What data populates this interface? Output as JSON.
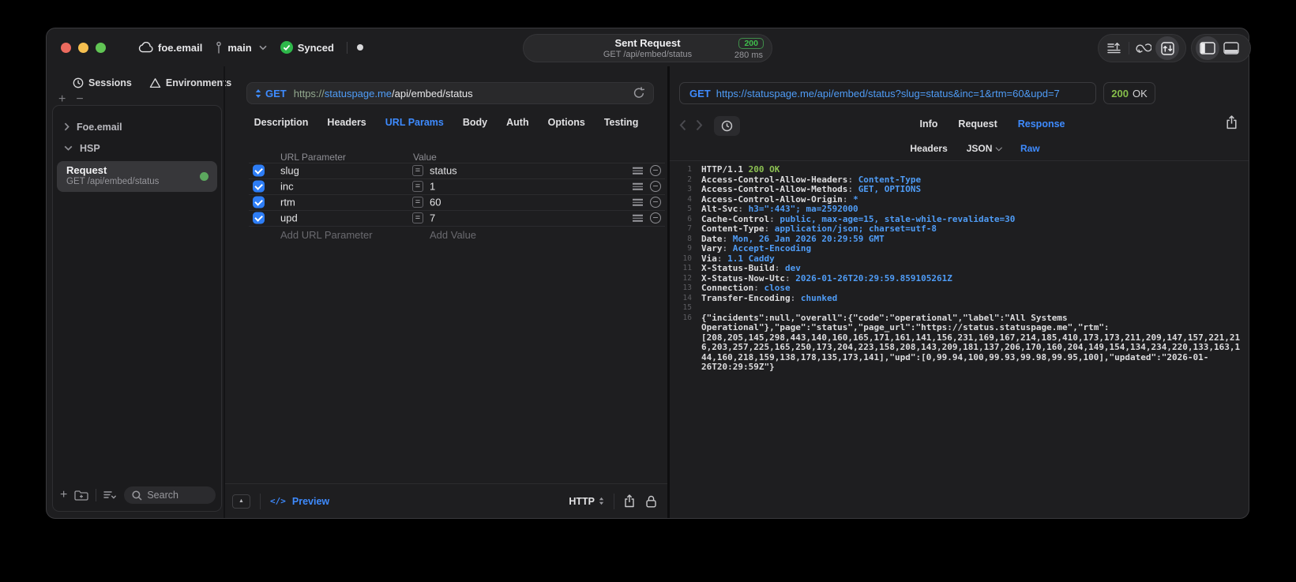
{
  "titlebar": {
    "project": "foe.email",
    "branch": "main",
    "sync_status": "Synced",
    "request_summary": {
      "title": "Sent Request",
      "status_code": "200",
      "method_path": "GET /api/embed/status",
      "duration": "280 ms"
    }
  },
  "sidebar": {
    "tabs": [
      {
        "label": "Sessions",
        "icon": "clock-icon"
      },
      {
        "label": "Environments",
        "icon": "environments-icon"
      }
    ],
    "groups": [
      {
        "label": "Foe.email",
        "state": "collapsed"
      },
      {
        "label": "HSP",
        "state": "expanded"
      }
    ],
    "request_item": {
      "title": "Request",
      "subtitle": "GET /api/embed/status",
      "status_dot_color": "#5CA85E"
    },
    "search": {
      "placeholder": "Search"
    }
  },
  "request_panel": {
    "method": "GET",
    "url": {
      "scheme": "https://",
      "host": "statuspage.me",
      "path": "/api/embed/status"
    },
    "tabs": [
      "Description",
      "Headers",
      "URL Params",
      "Body",
      "Auth",
      "Options",
      "Testing"
    ],
    "active_tab": "URL Params",
    "params_table": {
      "columns": [
        "URL Parameter",
        "Value"
      ],
      "rows": [
        {
          "name": "slug",
          "value": "status",
          "checked": true
        },
        {
          "name": "inc",
          "value": "1",
          "checked": true
        },
        {
          "name": "rtm",
          "value": "60",
          "checked": true
        },
        {
          "name": "upd",
          "value": "7",
          "checked": true
        }
      ],
      "add_row": {
        "name_placeholder": "Add URL Parameter",
        "value_placeholder": "Add Value"
      }
    },
    "footer": {
      "code_glyph": "</>",
      "preview_label": "Preview",
      "protocol": "HTTP"
    }
  },
  "response_panel": {
    "request_line": {
      "method": "GET",
      "url": "https://statuspage.me/api/embed/status?slug=status&inc=1&rtm=60&upd=7"
    },
    "status": {
      "code": "200",
      "text": "OK"
    },
    "tabs": [
      "Info",
      "Request",
      "Response"
    ],
    "active_tab": "Response",
    "subtabs": [
      {
        "label": "Headers",
        "dropdown": false
      },
      {
        "label": "JSON",
        "dropdown": true
      },
      {
        "label": "Raw",
        "dropdown": false
      }
    ],
    "active_subtab": "Raw",
    "code_lines": [
      {
        "n": "1",
        "segs": [
          {
            "t": "HTTP/1.1 ",
            "c": "plain"
          },
          {
            "t": "200 OK",
            "c": "green"
          }
        ]
      },
      {
        "n": "2",
        "segs": [
          {
            "t": "Access-Control-Allow-Headers",
            "c": "key"
          },
          {
            "t": ": ",
            "c": "punct"
          },
          {
            "t": "Content-Type",
            "c": "val"
          }
        ]
      },
      {
        "n": "3",
        "segs": [
          {
            "t": "Access-Control-Allow-Methods",
            "c": "key"
          },
          {
            "t": ": ",
            "c": "punct"
          },
          {
            "t": "GET, OPTIONS",
            "c": "val"
          }
        ]
      },
      {
        "n": "4",
        "segs": [
          {
            "t": "Access-Control-Allow-Origin",
            "c": "key"
          },
          {
            "t": ": ",
            "c": "punct"
          },
          {
            "t": "*",
            "c": "val"
          }
        ]
      },
      {
        "n": "5",
        "segs": [
          {
            "t": "Alt-Svc",
            "c": "key"
          },
          {
            "t": ": ",
            "c": "punct"
          },
          {
            "t": "h3=\":443\"; ma=2592000",
            "c": "val"
          }
        ]
      },
      {
        "n": "6",
        "segs": [
          {
            "t": "Cache-Control",
            "c": "key"
          },
          {
            "t": ": ",
            "c": "punct"
          },
          {
            "t": "public, max-age=15, stale-while-revalidate=30",
            "c": "val"
          }
        ]
      },
      {
        "n": "7",
        "segs": [
          {
            "t": "Content-Type",
            "c": "key"
          },
          {
            "t": ": ",
            "c": "punct"
          },
          {
            "t": "application/json; charset=utf-8",
            "c": "val"
          }
        ]
      },
      {
        "n": "8",
        "segs": [
          {
            "t": "Date",
            "c": "key"
          },
          {
            "t": ": ",
            "c": "punct"
          },
          {
            "t": "Mon, 26 Jan 2026 20:29:59 GMT",
            "c": "val"
          }
        ]
      },
      {
        "n": "9",
        "segs": [
          {
            "t": "Vary",
            "c": "key"
          },
          {
            "t": ": ",
            "c": "punct"
          },
          {
            "t": "Accept-Encoding",
            "c": "val"
          }
        ]
      },
      {
        "n": "10",
        "segs": [
          {
            "t": "Via",
            "c": "key"
          },
          {
            "t": ": ",
            "c": "punct"
          },
          {
            "t": "1.1 Caddy",
            "c": "val"
          }
        ]
      },
      {
        "n": "11",
        "segs": [
          {
            "t": "X-Status-Build",
            "c": "key"
          },
          {
            "t": ": ",
            "c": "punct"
          },
          {
            "t": "dev",
            "c": "val"
          }
        ]
      },
      {
        "n": "12",
        "segs": [
          {
            "t": "X-Status-Now-Utc",
            "c": "key"
          },
          {
            "t": ": ",
            "c": "punct"
          },
          {
            "t": "2026-01-26T20:29:59.859105261Z",
            "c": "val"
          }
        ]
      },
      {
        "n": "13",
        "segs": [
          {
            "t": "Connection",
            "c": "key"
          },
          {
            "t": ": ",
            "c": "punct"
          },
          {
            "t": "close",
            "c": "val"
          }
        ]
      },
      {
        "n": "14",
        "segs": [
          {
            "t": "Transfer-Encoding",
            "c": "key"
          },
          {
            "t": ": ",
            "c": "punct"
          },
          {
            "t": "chunked",
            "c": "val"
          }
        ]
      },
      {
        "n": "15",
        "segs": []
      },
      {
        "n": "16",
        "segs": [
          {
            "t": "{\"incidents\":null,\"overall\":{\"code\":\"operational\",\"label\":\"All Systems Operational\"},\"page\":\"status\",\"page_url\":\"https://status.statuspage.me\",\"rtm\":[208,205,145,298,443,140,160,165,171,161,141,156,231,169,167,214,185,410,173,173,211,209,147,157,221,216,203,257,225,165,250,173,204,223,158,208,143,209,181,137,206,170,160,204,149,154,134,234,220,133,163,144,160,218,159,138,178,135,173,141],\"upd\":[0,99.94,100,99.93,99.98,99.95,100],\"updated\":\"2026-01-26T20:29:59Z\"}",
            "c": "plain"
          }
        ]
      }
    ]
  },
  "colors": {
    "accent_blue": "#3E8BFF",
    "url_blue": "#4F9CF6",
    "status_green_badge": "#3FBF4C",
    "code_green": "#8CC152",
    "checkbox_blue": "#2D7DF6"
  }
}
